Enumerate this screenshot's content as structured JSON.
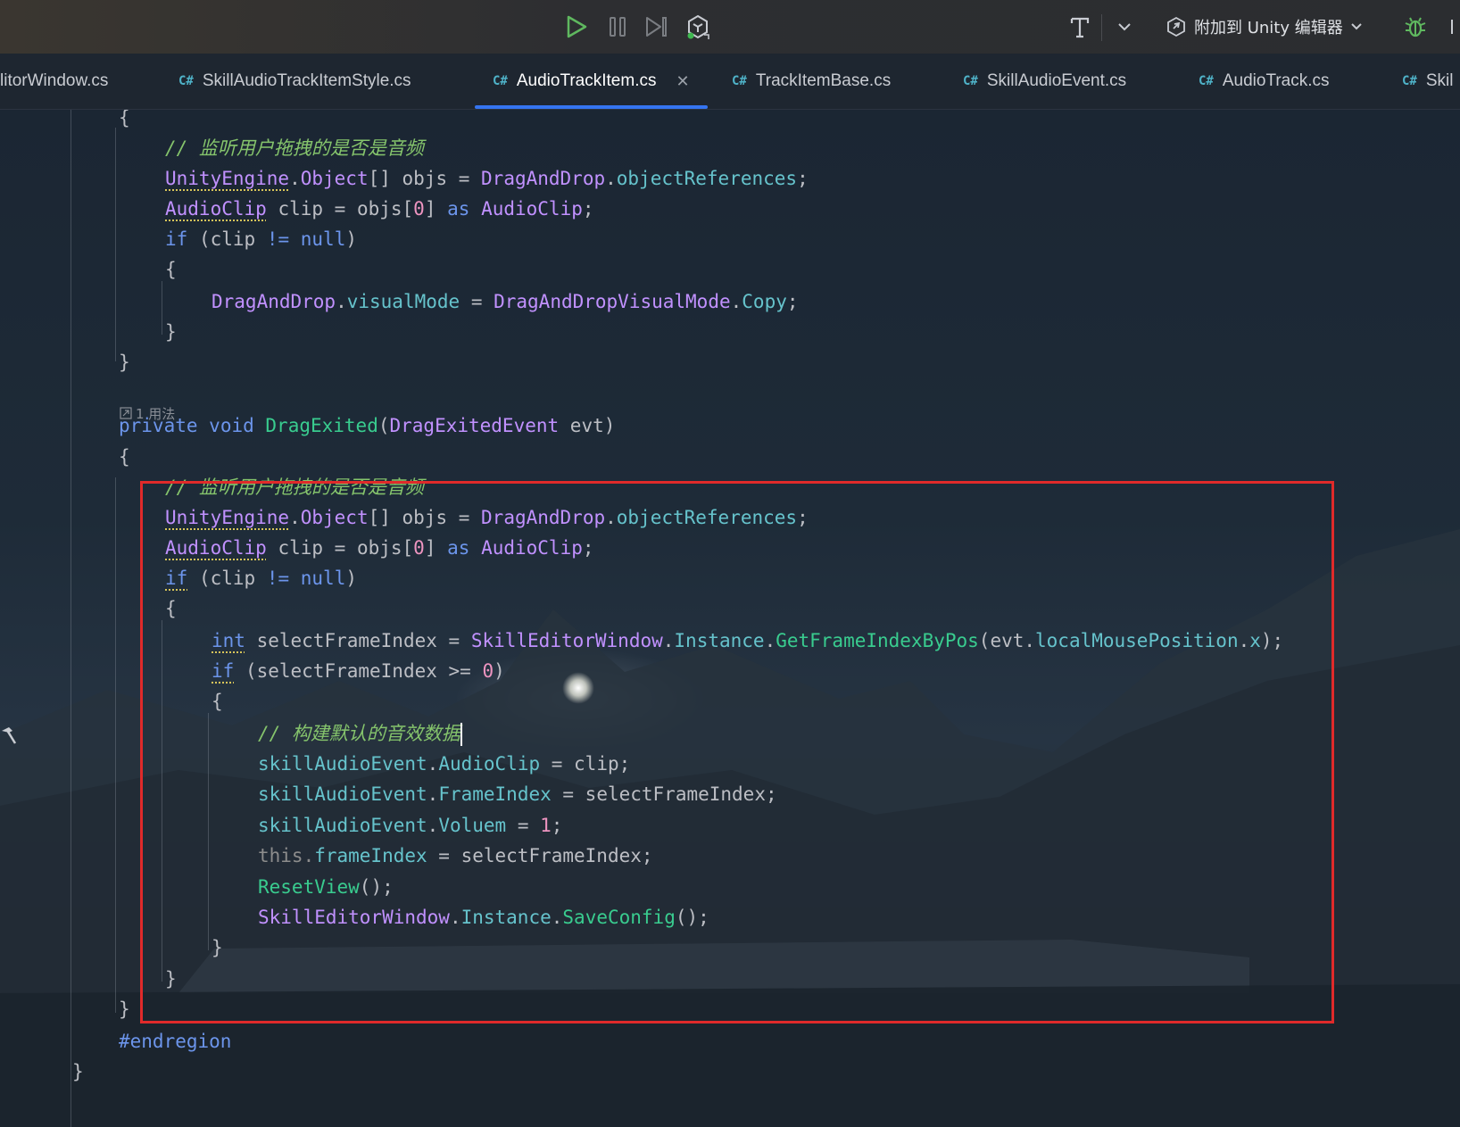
{
  "toolbar": {
    "run_icon": "play-icon",
    "pause_icon": "pause-icon",
    "step_icon": "step-icon",
    "debug_target_icon": "unity-debug-icon",
    "build_icon": "hammer-t-icon",
    "attach_label": "附加到 Unity 编辑器",
    "bug_icon": "bug-icon"
  },
  "tabs": [
    {
      "label": "litorWindow.cs",
      "lang": ""
    },
    {
      "label": "SkillAudioTrackItemStyle.cs",
      "lang": "C#"
    },
    {
      "label": "AudioTrackItem.cs",
      "lang": "C#",
      "active": true
    },
    {
      "label": "TrackItemBase.cs",
      "lang": "C#"
    },
    {
      "label": "SkillAudioEvent.cs",
      "lang": "C#"
    },
    {
      "label": "AudioTrack.cs",
      "lang": "C#"
    },
    {
      "label": "Skil",
      "lang": "C#"
    }
  ],
  "editor": {
    "usage_hint": "1 用法",
    "comment_check_audio": "// 监听用户拖拽的是否是音频",
    "comment_build_default": "// 构建默认的音效数据",
    "code": {
      "brace_open": "{",
      "brace_close": "}",
      "unity_engine": "UnityEngine",
      "object_arr": "Object",
      "objs_decl": "[] objs = ",
      "drag_and_drop": "DragAndDrop",
      "object_references": "objectReferences",
      "semicolon": ";",
      "dot": ".",
      "audio_clip": "AudioClip",
      "clip_decl": " clip = objs[",
      "zero": "0",
      "idx_close": "] ",
      "as_kw": "as",
      "if_kw": "if",
      "clip_ne": " (clip ",
      "ne_op": "!=",
      "null_kw": "null",
      "paren_close": ")",
      "visual_mode": "visualMode",
      "assign": " = ",
      "visual_mode_enum": "DragAndDropVisualMode",
      "copy": "Copy",
      "private_kw": "private",
      "void_kw": "void",
      "drag_exited": "DragExited",
      "paren_open": "(",
      "drag_exited_event": "DragExitedEvent",
      "evt_param": " evt)",
      "int_kw": "int",
      "select_decl": " selectFrameIndex = ",
      "skill_editor_window": "SkillEditorWindow",
      "instance": "Instance",
      "get_frame_index": "GetFrameIndexByPos",
      "evt_open": "(evt.",
      "local_mouse": "localMousePosition",
      "x_prop": "x",
      "close_stmt": ");",
      "if_select": " (selectFrameIndex >= ",
      "skill_audio_event": "skillAudioEvent",
      "audio_clip_prop": "AudioClip",
      "clip_end": " = clip;",
      "frame_index_prop": "FrameIndex",
      "select_end": " = selectFrameIndex;",
      "voluem": "Voluem",
      "one": "1",
      "this_kw": "this.",
      "frame_index_field": "frameIndex",
      "reset_view": "ResetView",
      "call_empty": "();",
      "save_config": "SaveConfig",
      "endregion": "#endregion"
    }
  },
  "colors": {
    "keyword": "#6c95eb",
    "type": "#c191ff",
    "property": "#66c3cc",
    "method": "#39cc8f",
    "number": "#ed94c0",
    "comment": "#85c46c",
    "highlight_border": "#e02a2a",
    "active_tab_underline": "#3574f0"
  }
}
